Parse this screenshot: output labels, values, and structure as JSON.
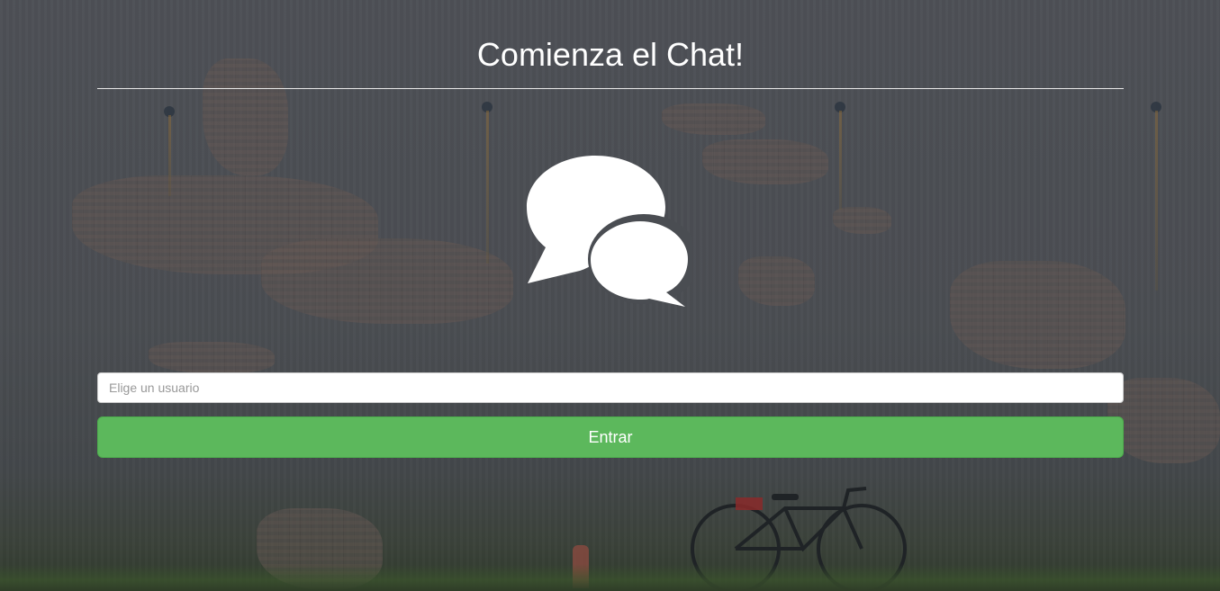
{
  "header": {
    "title": "Comienza el Chat!"
  },
  "icon": {
    "name": "chat-bubbles-icon"
  },
  "login_form": {
    "username_placeholder": "Elige un usuario",
    "username_value": "",
    "submit_label": "Entrar"
  },
  "colors": {
    "accent_button": "#5cb85c",
    "title_text": "#ffffff",
    "background": "#4a4d52"
  }
}
